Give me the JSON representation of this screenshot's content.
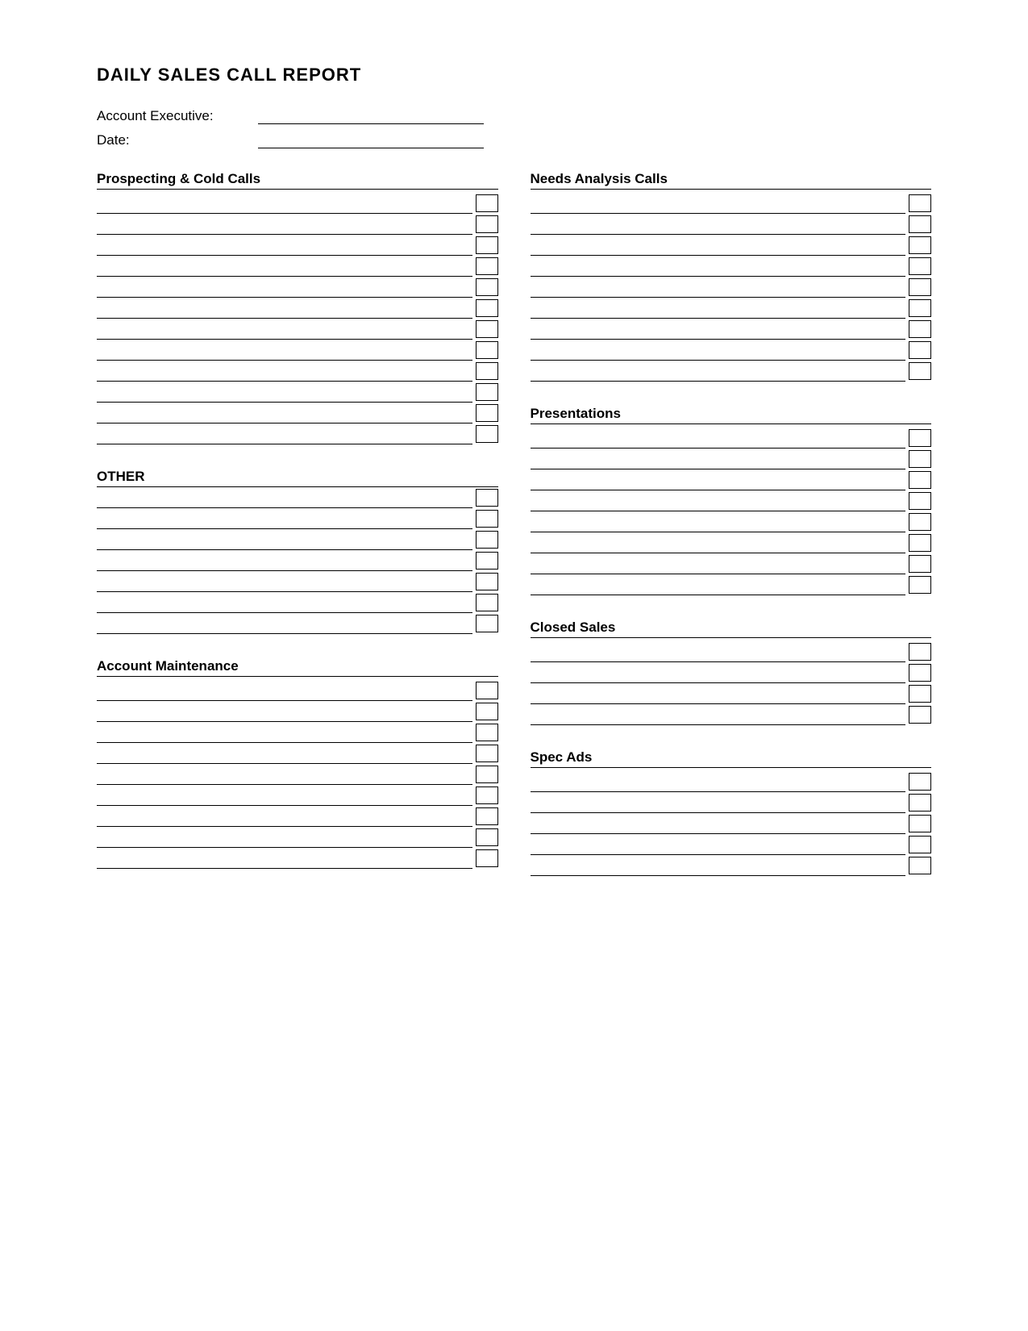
{
  "title": "DAILY SALES CALL REPORT",
  "header": {
    "account_executive_label": "Account Executive:",
    "date_label": "Date:"
  },
  "sections": {
    "prospecting": {
      "title": "Prospecting & Cold Calls",
      "rows": 12
    },
    "other": {
      "title": "OTHER",
      "rows": 7
    },
    "needs_analysis": {
      "title": "Needs Analysis Calls",
      "rows": 9
    },
    "presentations": {
      "title": "Presentations",
      "rows": 8
    },
    "account_maintenance": {
      "title": "Account Maintenance",
      "rows": 9
    },
    "closed_sales": {
      "title": "Closed Sales",
      "rows": 4
    },
    "spec_ads": {
      "title": "Spec Ads",
      "rows": 5
    }
  }
}
